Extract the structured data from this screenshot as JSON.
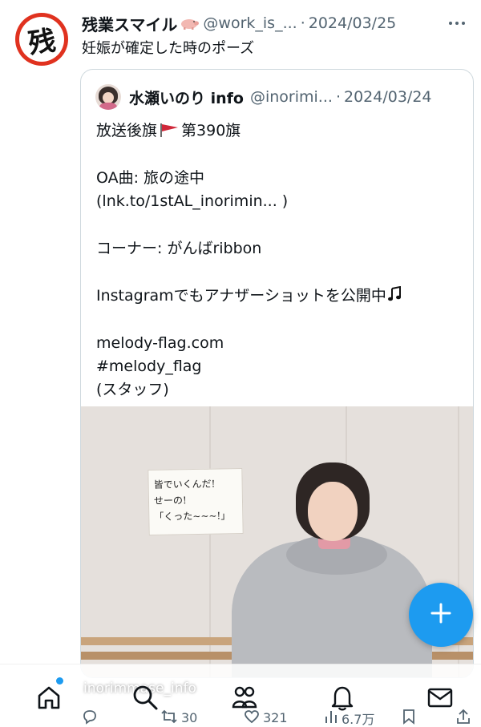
{
  "tweet": {
    "author_name": "残業スマイル",
    "author_handle": "@work_is_...",
    "separator": "·",
    "date": "2024/03/25",
    "avatar_char": "残",
    "text": "妊娠が確定した時のポーズ"
  },
  "quote": {
    "author_name": "水瀬いのり info",
    "author_handle": "@inorimi...",
    "separator": "·",
    "date": "2024/03/24",
    "lines": {
      "l1a": "放送後旗",
      "l1b": "第390旗",
      "l2": "OA曲: 旅の途中",
      "l3": "(lnk.to/1stAL_inorimin... )",
      "l4": "コーナー: がんばribbon",
      "l5": "Instagramでもアナザーショットを公開中",
      "l6": "melody-flag.com",
      "l7": "#melody_flag",
      "l8": "(スタッフ)"
    },
    "photo": {
      "sign_lines": [
        "皆でいくんだ!",
        "せーの!",
        "「くった~~~!」"
      ],
      "credit": "inorimmase_info"
    }
  },
  "actions": {
    "retweets": "30",
    "likes": "321",
    "views": "6.7万"
  },
  "icons": {
    "reply": "reply-icon",
    "retweet": "retweet-icon",
    "like": "heart-icon",
    "views": "views-icon",
    "bookmark": "bookmark-icon",
    "share": "share-icon",
    "home": "home-icon",
    "search": "search-icon",
    "communities": "communities-icon",
    "notifications": "bell-icon",
    "messages": "mail-icon",
    "compose": "plus-icon"
  },
  "colors": {
    "accent": "#1d9bf0",
    "text": "#0f1419",
    "muted": "#536471",
    "avatar_red": "#e0321f"
  }
}
